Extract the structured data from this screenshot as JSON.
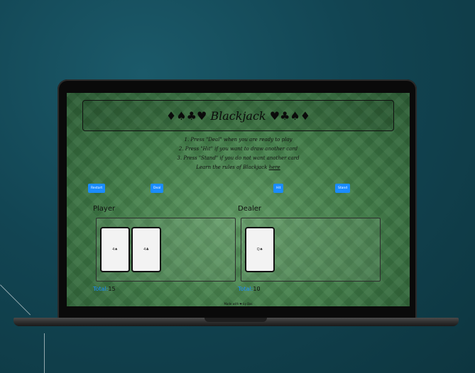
{
  "game": {
    "title": "♦♠♣♥ Blackjack ♥♣♠♦",
    "rules": [
      "1. Press \"Deal\" when you are ready to play",
      "2. Press \"Hit\" if you want to draw another card",
      "3. Press \"Stand\" if you do not want another card"
    ],
    "learn_text": "Learn the rules of Blackjack ",
    "learn_link": "here"
  },
  "buttons": {
    "restart": "Restart",
    "deal": "Deal",
    "hit": "Hit",
    "stand": "Stand"
  },
  "player": {
    "label": "Player",
    "cards": [
      "4♠",
      "4♣"
    ],
    "total_label": "Total:",
    "total": "15"
  },
  "dealer": {
    "label": "Dealer",
    "cards": [
      "Q♠"
    ],
    "total_label": "Total:",
    "total": "10"
  },
  "footer": {
    "text": "Made with ❤ by Bas"
  },
  "colors": {
    "button": "#1a8cff",
    "felt": "#4a8a50",
    "background": "#124553"
  }
}
